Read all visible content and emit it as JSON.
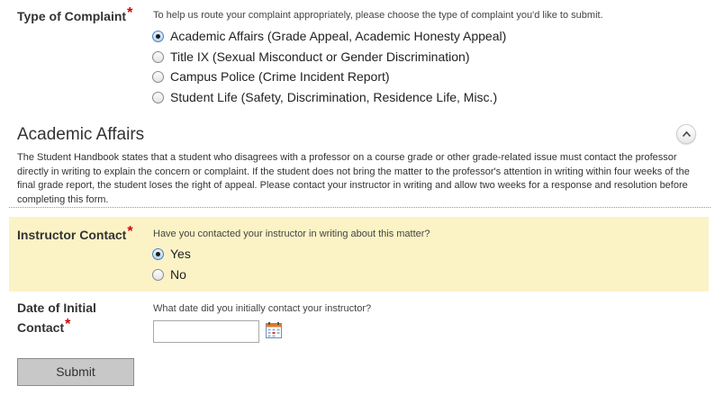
{
  "complaint": {
    "label": "Type of Complaint",
    "required_mark": "*",
    "help": "To help us route your complaint appropriately, please choose the type of complaint you'd like to submit.",
    "options": [
      {
        "label": "Academic Affairs (Grade Appeal, Academic Honesty Appeal)",
        "checked": true
      },
      {
        "label": "Title IX (Sexual Misconduct or Gender Discrimination)",
        "checked": false
      },
      {
        "label": "Campus Police (Crime Incident Report)",
        "checked": false
      },
      {
        "label": "Student Life (Safety, Discrimination, Residence Life, Misc.)",
        "checked": false
      }
    ]
  },
  "section": {
    "title": "Academic Affairs",
    "description": "The Student Handbook states that a student who disagrees with a professor on a course grade or other grade-related issue must contact the professor directly in writing to explain the concern or complaint. If the student does not bring the matter to the professor's attention in writing within four weeks of the final grade report, the student loses the right of appeal. Please contact your instructor in writing and allow two weeks for a response and resolution before completing this form."
  },
  "instructor_contact": {
    "label": "Instructor Contact",
    "required_mark": "*",
    "help": "Have you contacted your instructor in writing about this matter?",
    "options": [
      {
        "label": "Yes",
        "checked": true
      },
      {
        "label": "No",
        "checked": false
      }
    ],
    "highlight_color": "#fbf3c6"
  },
  "initial_contact": {
    "label_line1": "Date of Initial",
    "label_line2": "Contact",
    "required_mark": "*",
    "help": "What date did you initially contact your instructor?",
    "value": "",
    "icon": "calendar-icon"
  },
  "submit": {
    "label": "Submit"
  },
  "colors": {
    "required": "#cc0000",
    "radio_selected": "#4a7fbf"
  }
}
